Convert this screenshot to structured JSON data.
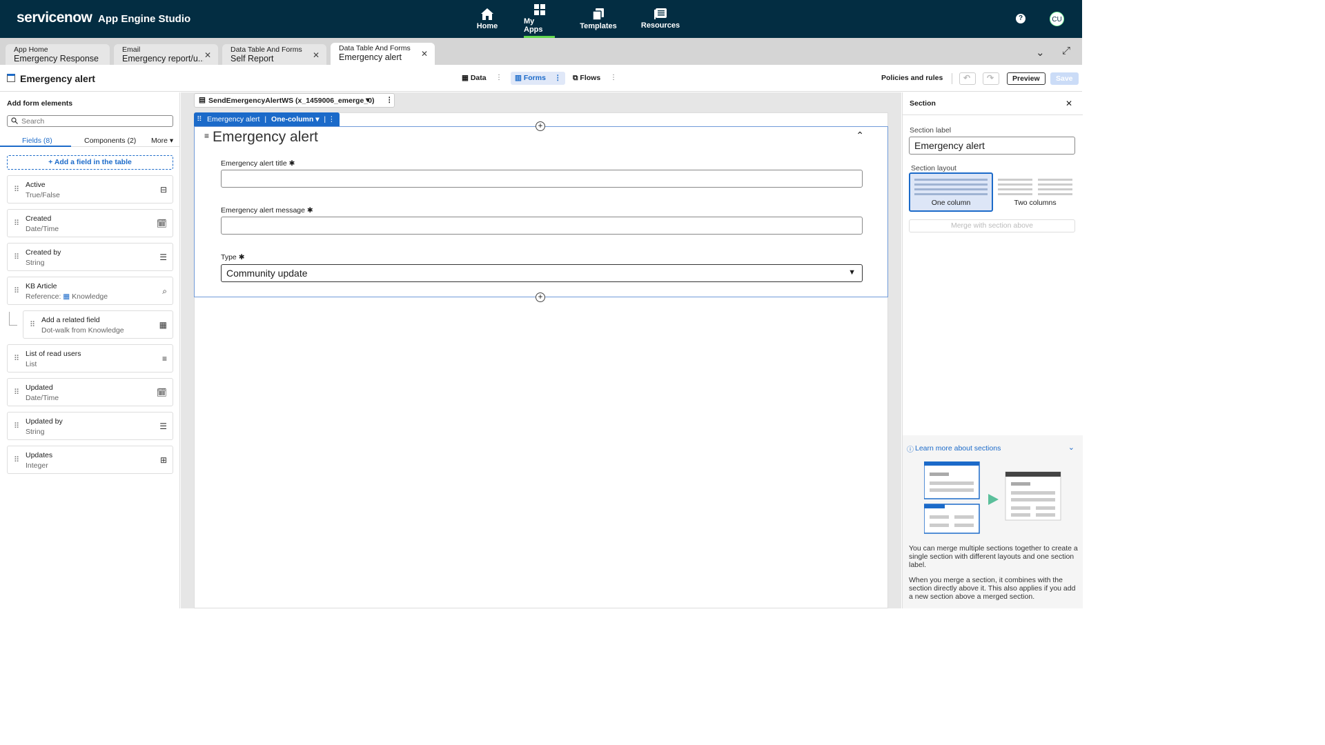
{
  "app": {
    "brand": "servicenow",
    "product": "App Engine Studio"
  },
  "nav": [
    {
      "label": "Home",
      "icon": "home-icon"
    },
    {
      "label": "My Apps",
      "icon": "apps-grid-icon",
      "active": true
    },
    {
      "label": "Templates",
      "icon": "templates-icon"
    },
    {
      "label": "Resources",
      "icon": "resources-icon"
    }
  ],
  "user_initials": "CU",
  "tabs": [
    {
      "title": "App Home",
      "subtitle": "Emergency Response",
      "closable": false
    },
    {
      "title": "Email",
      "subtitle": "Emergency report/u...",
      "closable": true
    },
    {
      "title": "Data Table And Forms",
      "subtitle": "Self Report",
      "closable": true
    },
    {
      "title": "Data Table And Forms",
      "subtitle": "Emergency alert",
      "closable": true,
      "active": true
    }
  ],
  "header": {
    "title": "Emergency alert",
    "modes": [
      "Data",
      "Forms",
      "Flows"
    ],
    "active_mode": "Forms",
    "policies": "Policies and rules",
    "preview": "Preview",
    "save": "Save"
  },
  "left": {
    "title": "Add form elements",
    "search_placeholder": "Search",
    "tabs": [
      "Fields (8)",
      "Components (2)",
      "More"
    ],
    "add_field": "+ Add a field in the table",
    "fields": [
      {
        "name": "Active",
        "type": "True/False",
        "icon": "toggle-icon"
      },
      {
        "name": "Created",
        "type": "Date/Time",
        "icon": "calendar-clock-icon"
      },
      {
        "name": "Created by",
        "type": "String",
        "icon": "text-lines-icon"
      },
      {
        "name": "KB Article",
        "type": "Reference:",
        "ref": "Knowledge",
        "icon": "search-icon"
      },
      {
        "name": "Add a related field",
        "type": "Dot-walk from Knowledge",
        "icon": "table-icon",
        "nested": true
      },
      {
        "name": "List of read users",
        "type": "List",
        "icon": "list-icon"
      },
      {
        "name": "Updated",
        "type": "Date/Time",
        "icon": "calendar-clock-icon"
      },
      {
        "name": "Updated by",
        "type": "String",
        "icon": "text-lines-icon"
      },
      {
        "name": "Updates",
        "type": "Integer",
        "icon": "integer-icon"
      }
    ]
  },
  "canvas": {
    "form_name": "SendEmergencyAlertWS (x_1459006_emerge_0)",
    "section_badge": "Emergency alert",
    "section_layout": "One-column",
    "section_title": "Emergency alert",
    "fields": [
      {
        "label": "Emergency alert title",
        "required": true,
        "value": ""
      },
      {
        "label": "Emergency alert message",
        "required": true,
        "value": ""
      },
      {
        "label": "Type",
        "required": true,
        "value": "Community update"
      }
    ]
  },
  "right": {
    "title": "Section",
    "label_caption": "Section label",
    "label_value": "Emergency alert",
    "layout_caption": "Section layout",
    "layouts": [
      "One column",
      "Two columns"
    ],
    "merge": "Merge with section above",
    "learn": "Learn more about sections",
    "p1": "You can merge multiple sections together to create a single section with different layouts and one section label.",
    "p2": "When you merge a section, it combines with the section directly above it. This also applies if you add a new section above a merged section."
  },
  "colors": {
    "topbar": "#032d42",
    "accent": "#1b6ac9",
    "active_nav": "#62d84e"
  }
}
